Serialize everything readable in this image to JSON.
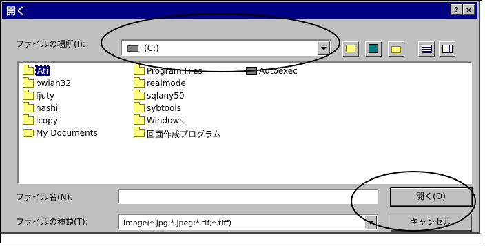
{
  "title": "開く",
  "title_buttons": [
    "?",
    "×"
  ],
  "lookin": {
    "label": "ファイルの場所(I):",
    "value": "(C:)",
    "icon": "drive-icon"
  },
  "toolbar": {
    "up_icon": "up-folder-icon",
    "desktop_icon": "desktop-icon",
    "newfolder_icon": "new-folder-icon",
    "list_icon": "list-view-icon",
    "details_icon": "details-view-icon"
  },
  "files": {
    "col1": [
      "Ati",
      "bwlan32",
      "fjuty",
      "hashi",
      "lcopy",
      "My Documents"
    ],
    "col2": [
      "Program Files",
      "realmode",
      "sqlany50",
      "sybtools",
      "Windows",
      "回面作成プログラム"
    ],
    "col3": [
      "Autoexec"
    ]
  },
  "filename": {
    "label": "ファイル名(N):",
    "value": ""
  },
  "filetype": {
    "label": "ファイルの種類(T):",
    "value": "Image(*.jpg;*.jpeg;*.tif;*.tiff)"
  },
  "buttons": {
    "open": "開く(O)",
    "cancel": "キャンセル"
  },
  "colors": {
    "titlebar": "#000082",
    "face": "#c0c0c0",
    "annotation": "#000000"
  }
}
